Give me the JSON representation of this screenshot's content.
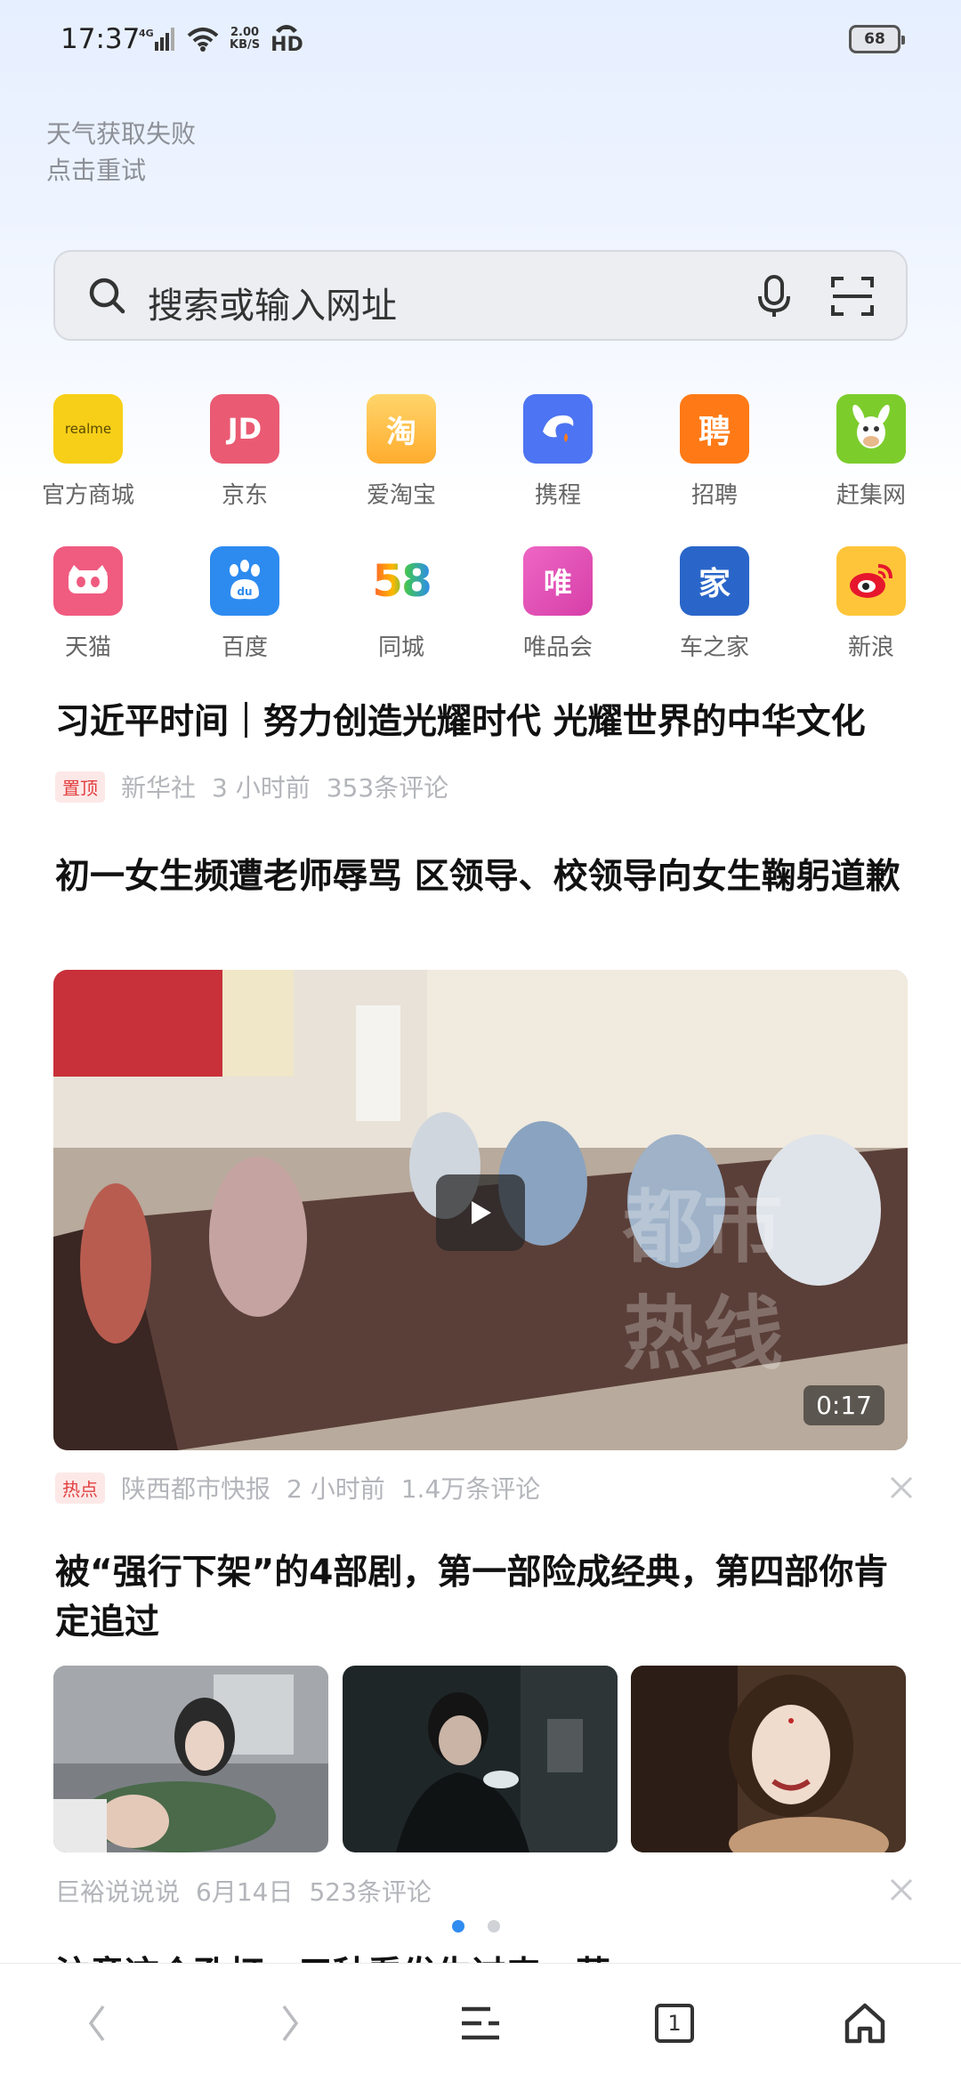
{
  "status_bar": {
    "time": "17:37",
    "network": "4G",
    "speed_value": "2.00",
    "speed_unit": "KB/S",
    "hd": "HD",
    "battery": "68"
  },
  "weather": {
    "line1": "天气获取失败",
    "line2": "点击重试"
  },
  "search": {
    "placeholder": "搜索或输入网址"
  },
  "shortcuts": [
    {
      "label": "官方商城",
      "icon": "realme-icon",
      "icon_text": "realme",
      "color": "#f7cf18"
    },
    {
      "label": "京东",
      "icon": "jd-icon",
      "icon_text": "JD",
      "color": "#ea5a73"
    },
    {
      "label": "爱淘宝",
      "icon": "taobao-icon",
      "icon_text": "淘",
      "color": "#ffb53a"
    },
    {
      "label": "携程",
      "icon": "ctrip-icon",
      "icon_text": "",
      "color": "#4d74f2"
    },
    {
      "label": "招聘",
      "icon": "zhaopin-icon",
      "icon_text": "聘",
      "color": "#ff7a16"
    },
    {
      "label": "赶集网",
      "icon": "ganji-icon",
      "icon_text": "",
      "color": "#7ccd2c"
    },
    {
      "label": "天猫",
      "icon": "tmall-icon",
      "icon_text": "",
      "color": "#f05b80"
    },
    {
      "label": "百度",
      "icon": "baidu-icon",
      "icon_text": "du",
      "color": "#2d8bf0"
    },
    {
      "label": "同城",
      "icon": "58-icon",
      "icon_text": "58",
      "color": "#ffffff"
    },
    {
      "label": "唯品会",
      "icon": "vip-icon",
      "icon_text": "唯",
      "color": "#e34fb9"
    },
    {
      "label": "车之家",
      "icon": "autohome-icon",
      "icon_text": "家",
      "color": "#2a66c9"
    },
    {
      "label": "新浪",
      "icon": "sina-icon",
      "icon_text": "",
      "color": "#ffc53a"
    }
  ],
  "news": [
    {
      "title": "习近平时间｜努力创造光耀时代 光耀世界的中华文化",
      "tag": "置顶",
      "source": "新华社",
      "time": "3 小时前",
      "comments": "353条评论"
    },
    {
      "title": "初一女生频遭老师辱骂  区领导、校领导向女生鞠躬道歉",
      "duration": "0:17",
      "tag": "热点",
      "source": "陕西都市快报",
      "time": "2 小时前",
      "comments": "1.4万条评论"
    },
    {
      "title": "被“强行下架”的4部剧，第一部险成经典，第四部你肯定追过",
      "source": "巨裕说说说",
      "time": "6月14日",
      "comments": "523条评论"
    }
  ],
  "peek_title": "注意这个孔打，三种看发生过来：草",
  "pagination": {
    "current": 1,
    "total": 2
  },
  "bottom_nav": {
    "tabs_count": "1"
  }
}
